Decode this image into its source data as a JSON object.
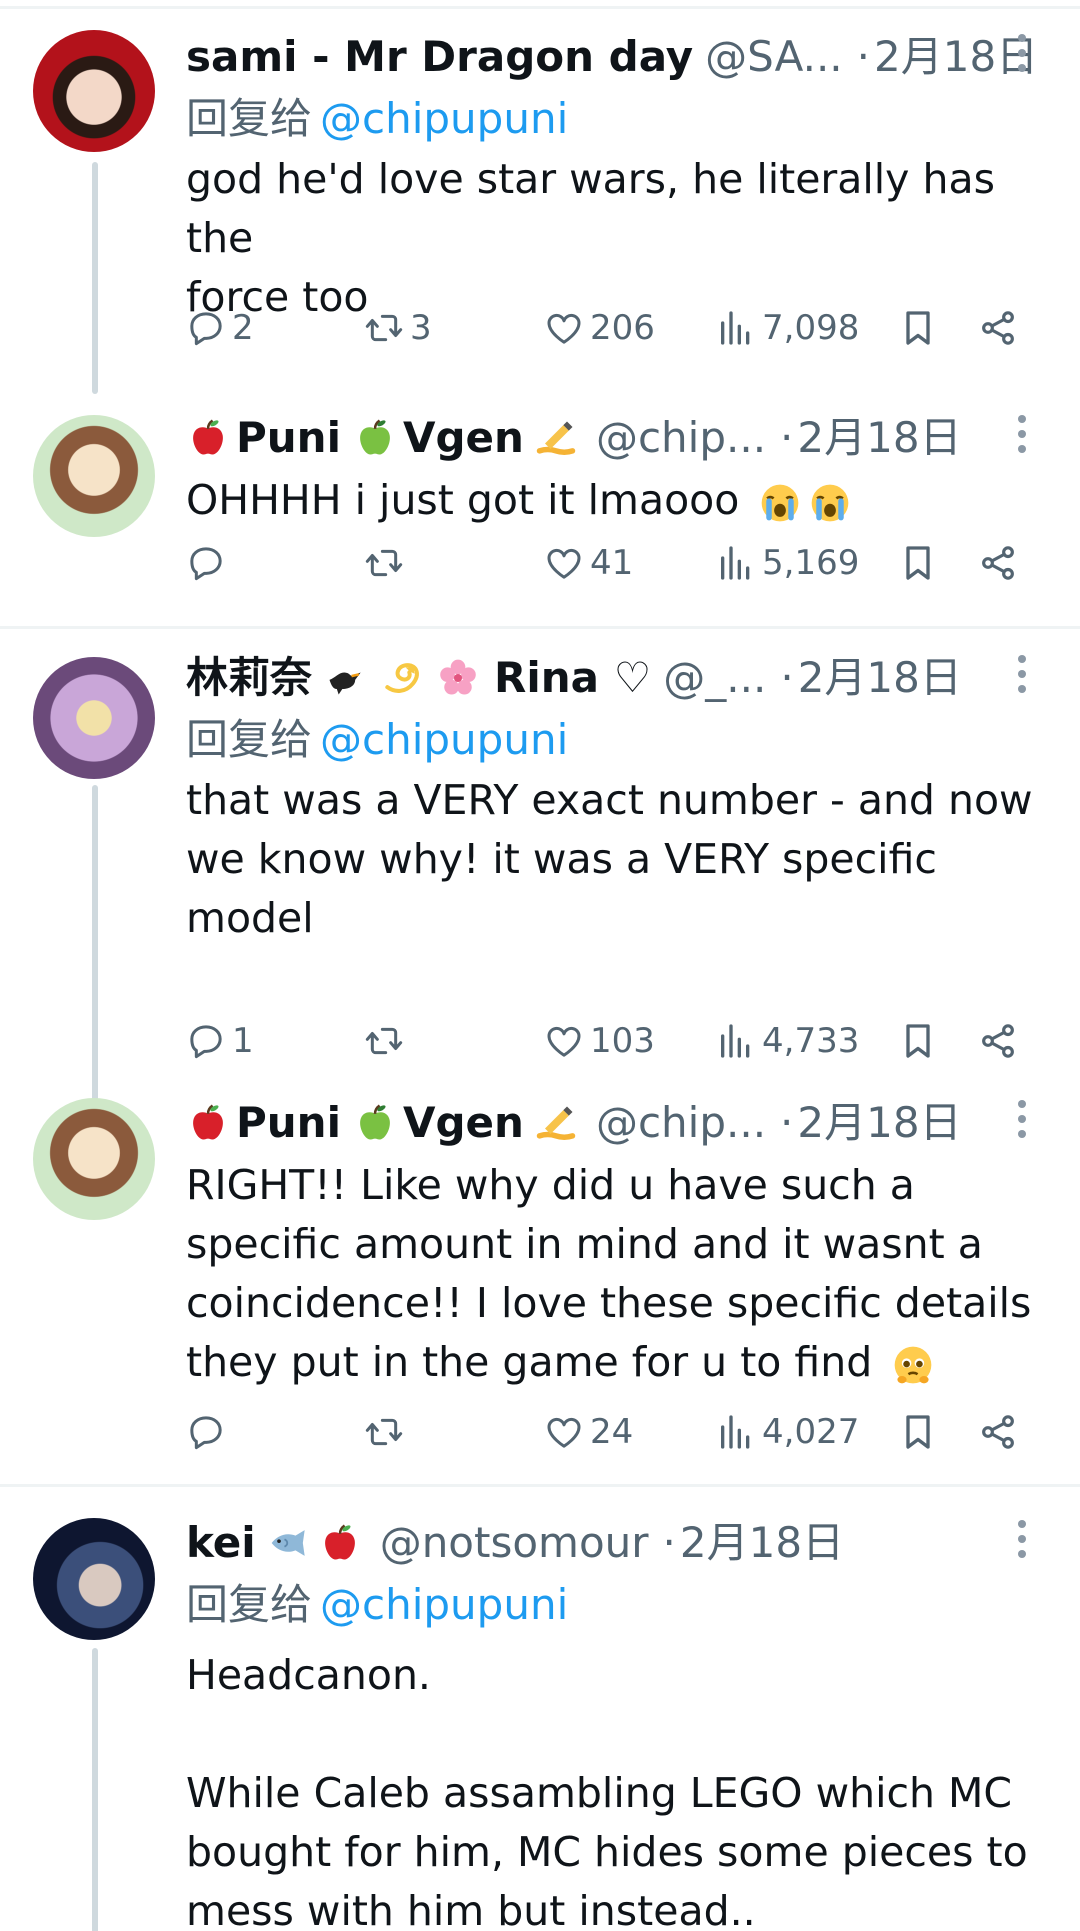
{
  "tweets": [
    {
      "name": "sami - Mr Dragon day",
      "handle": "@SA...",
      "dot": "·",
      "date": "2月18日",
      "reply_label": "回复给",
      "reply_mention": "@chipupuni",
      "text": "god he'd love star wars, he literally has the\nforce too",
      "replies": "2",
      "retweets": "3",
      "likes": "206",
      "views": "7,098",
      "avatar_colors": [
        "#b3121b",
        "#f3d8c8",
        "#2a1a14"
      ]
    },
    {
      "name_a": "Puni",
      "name_b": "Vgen",
      "handle": "@chip...",
      "dot": "·",
      "date": "2月18日",
      "text": "OHHHH i just got it lmaooo",
      "replies": "",
      "retweets": "",
      "likes": "41",
      "views": "5,169",
      "avatar_colors": [
        "#cfe8c8",
        "#8b5a3c",
        "#f6e3c8"
      ]
    },
    {
      "name_a": "林莉奈",
      "name_b": "Rina ♡",
      "handle": "@_...",
      "dot": "·",
      "date": "2月18日",
      "reply_label": "回复给",
      "reply_mention": "@chipupuni",
      "text": "that was a VERY exact number - and now\nwe know why! it was a VERY specific\nmodel",
      "replies": "1",
      "retweets": "",
      "likes": "103",
      "views": "4,733",
      "avatar_colors": [
        "#6b4a7a",
        "#c9a6d8",
        "#f2e1a8"
      ]
    },
    {
      "name_a": "Puni",
      "name_b": "Vgen",
      "handle": "@chip...",
      "dot": "·",
      "date": "2月18日",
      "text": "RIGHT!! Like why did u have such a\nspecific amount in mind and it wasnt a\ncoincidence!! I love these specific details\nthey put in the game for u to find",
      "replies": "",
      "retweets": "",
      "likes": "24",
      "views": "4,027",
      "avatar_colors": [
        "#cfe8c8",
        "#8b5a3c",
        "#f6e3c8"
      ]
    },
    {
      "name": "kei",
      "handle": "@notsomour",
      "dot": "·",
      "date": "2月18日",
      "reply_label": "回复给",
      "reply_mention": "@chipupuni",
      "text": "Headcanon.\n\nWhile Caleb assambling LEGO which MC\nbought for him, MC hides some pieces to\nmess with him but instead..",
      "avatar_colors": [
        "#0e1630",
        "#3b4f7a",
        "#d9c9c0"
      ]
    }
  ],
  "colors": {
    "text": "#0f1419",
    "secondary": "#536471",
    "link": "#1d9bf0",
    "border": "#eff3f4",
    "thread": "#cfd9de"
  },
  "icons": [
    "reply-icon",
    "retweet-icon",
    "like-icon",
    "views-icon",
    "bookmark-icon",
    "share-icon",
    "more-icon",
    "red-apple-emoji",
    "green-apple-emoji",
    "writing-hand-emoji",
    "crying-face-emoji",
    "black-bird-emoji",
    "dizzy-emoji",
    "cherry-blossom-emoji",
    "fish-emoji",
    "pleading-face-emoji"
  ]
}
